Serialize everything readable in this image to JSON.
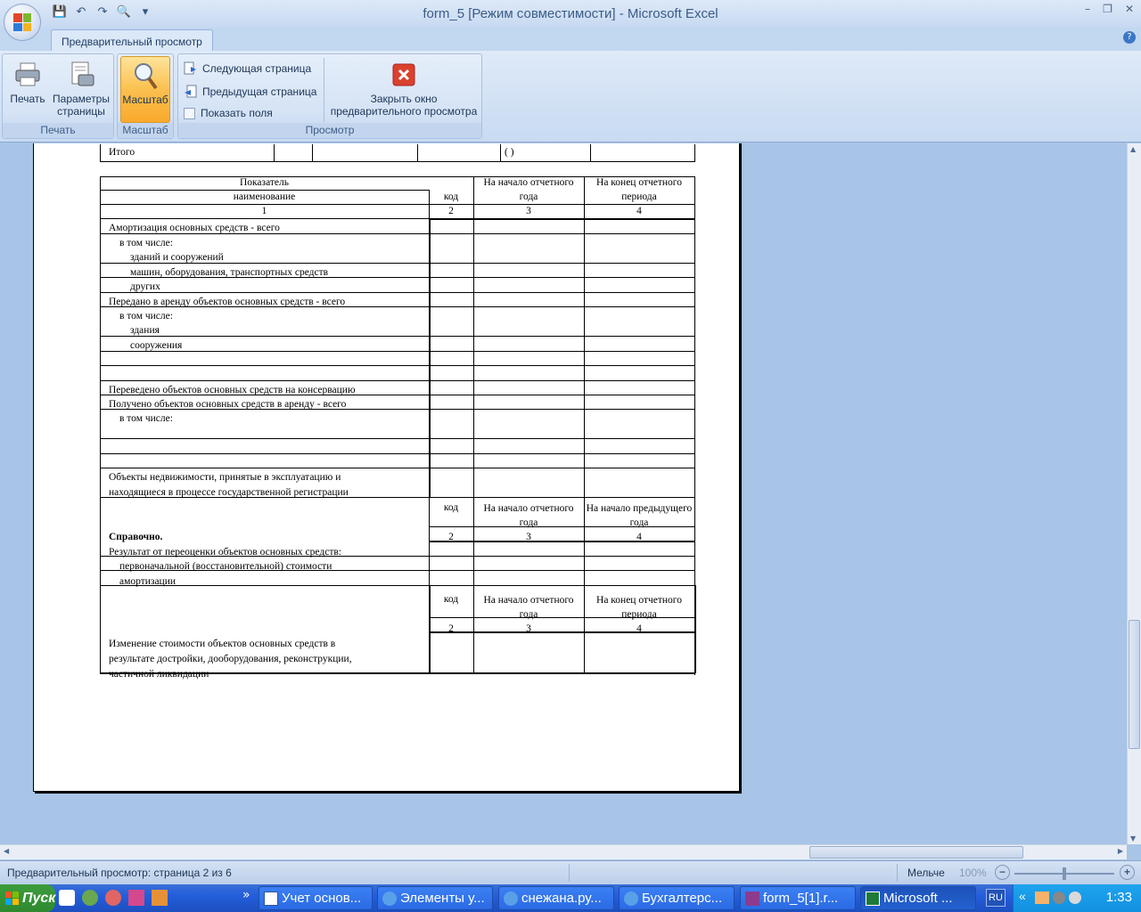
{
  "window": {
    "title": "form_5  [Режим совместимости] - Microsoft Excel"
  },
  "qat": {
    "icons": [
      "save-icon",
      "undo-icon",
      "redo-icon",
      "print-preview-icon",
      "customize-icon"
    ]
  },
  "ribbon": {
    "tab": "Предварительный просмотр",
    "groups": {
      "print": {
        "label": "Печать",
        "print_btn": "Печать",
        "params_btn_l1": "Параметры",
        "params_btn_l2": "страницы"
      },
      "zoom": {
        "label": "Масштаб",
        "zoom_btn": "Масштаб"
      },
      "preview": {
        "label": "Просмотр",
        "next": "Следующая страница",
        "prev": "Предыдущая страница",
        "show_margins": "Показать поля",
        "close_l1": "Закрыть окно",
        "close_l2": "предварительного просмотра"
      }
    }
  },
  "sheet": {
    "top_row": {
      "label": "Итого",
      "paren": "(                    )"
    },
    "header": {
      "indicator": "Показатель",
      "name": "наименование",
      "code": "код",
      "start": "На начало отчетного года",
      "end": "На конец отчетного периода",
      "n1": "1",
      "n2": "2",
      "n3": "3",
      "n4": "4"
    },
    "rows": [
      "Амортизация основных средств - всего",
      "в том числе:",
      "зданий и сооружений",
      "машин, оборудования, транспортных средств",
      "других",
      "Передано в аренду объектов основных средств - всего",
      "в том числе:",
      "здания",
      "сооружения",
      "",
      "",
      "Переведено объектов основных средств на консервацию",
      "Получено объектов основных средств в аренду - всего",
      "в том числе:",
      "",
      "",
      "Объекты недвижимости, принятые в эксплуатацию и",
      "находящиеся в процессе государственной регистрации"
    ],
    "ref": {
      "code": "код",
      "start": "На начало отчетного года",
      "prev": "На начало предыдущего года",
      "title": "Справочно.",
      "n2": "2",
      "n3": "3",
      "n4": "4",
      "rows": [
        "Результат от переоценки объектов основных средств:",
        "первоначальной (восстановительной) стоимости",
        "амортизации"
      ]
    },
    "last": {
      "code": "код",
      "start": "На начало отчетного года",
      "end": "На конец отчетного периода",
      "n2": "2",
      "n3": "3",
      "n4": "4",
      "l1": "Изменение стоимости объектов основных средств в",
      "l2": "результате достройки, дооборудования, реконструкции,",
      "l3": "частичной ликвидации"
    }
  },
  "status": {
    "text": "Предварительный просмотр: страница 2 из 6",
    "zoom_out": "Мельче",
    "zoom_pct": "100%"
  },
  "taskbar": {
    "start": "Пуск",
    "items": [
      "Учет основ...",
      "Элементы у...",
      "снежана.ру...",
      "Бухгалтерс...",
      "form_5[1].r...",
      "Microsoft ..."
    ],
    "lang": "RU",
    "clock": "1:33"
  }
}
